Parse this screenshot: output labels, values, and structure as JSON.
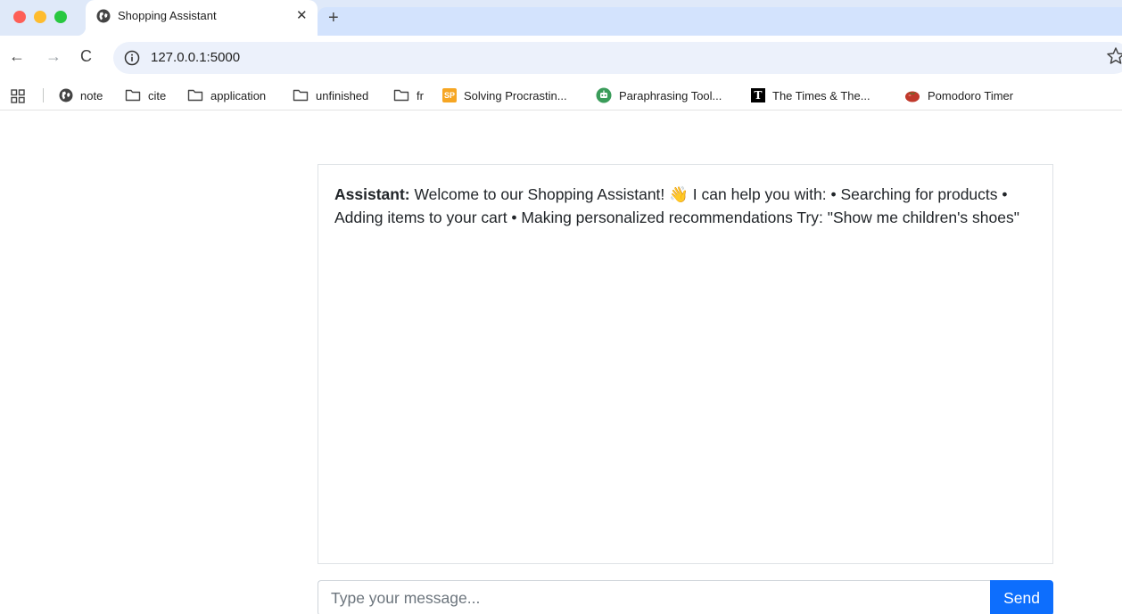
{
  "tab": {
    "title": "Shopping Assistant",
    "close_glyph": "✕",
    "new_tab_glyph": "+",
    "favicon": "globe-icon"
  },
  "toolbar": {
    "back_glyph": "←",
    "forward_glyph": "→",
    "reload_glyph": "C",
    "url": "127.0.0.1:5000"
  },
  "bookmarks": [
    {
      "label": "note",
      "icon": "globe-icon"
    },
    {
      "label": "cite",
      "icon": "folder-icon"
    },
    {
      "label": "application",
      "icon": "folder-icon"
    },
    {
      "label": "unfinished",
      "icon": "folder-icon"
    },
    {
      "label": "fr",
      "icon": "folder-icon"
    },
    {
      "label": "Solving Procrastin...",
      "icon": "sp-icon",
      "badge": "SP"
    },
    {
      "label": "Paraphrasing Tool...",
      "icon": "paraphrase-icon"
    },
    {
      "label": "The Times & The...",
      "icon": "times-icon",
      "badge": "T"
    },
    {
      "label": "Pomodoro Timer",
      "icon": "tomato-icon"
    }
  ],
  "chat": {
    "sender": "Assistant:",
    "message": " Welcome to our Shopping Assistant! 👋 I can help you with: • Searching for products • Adding items to your cart • Making personalized recommendations Try: \"Show me children's shoes\""
  },
  "input": {
    "placeholder": "Type your message...",
    "send_label": "Send"
  },
  "colors": {
    "send_button": "#0d6efd",
    "tab_strip": "#dfe9f9",
    "omnibox": "#ecf1fb"
  }
}
